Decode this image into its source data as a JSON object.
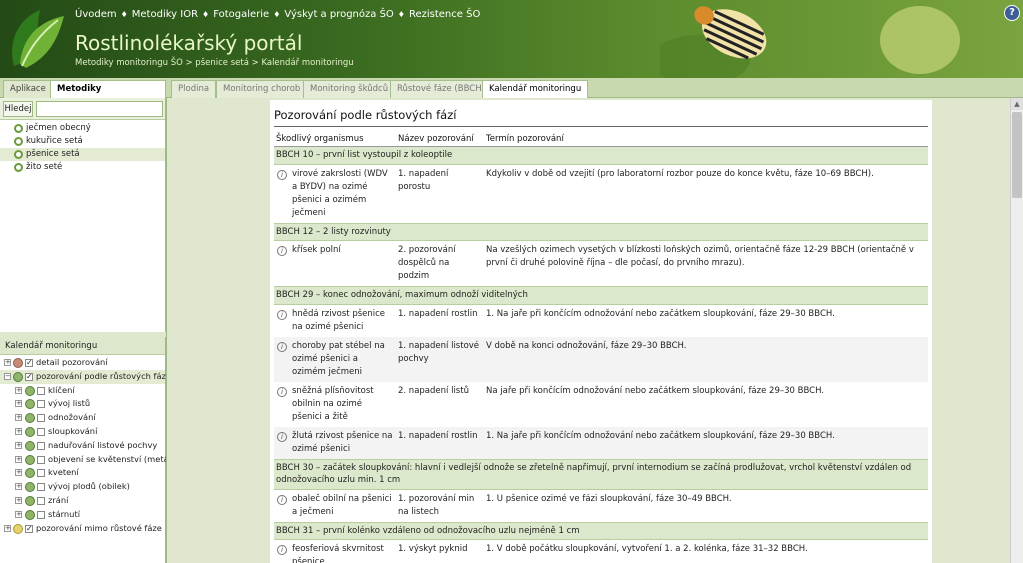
{
  "header": {
    "nav": [
      "Úvodem",
      "Metodiky IOR",
      "Fotogalerie",
      "Výskyt a prognóza ŠO",
      "Rezistence ŠO"
    ],
    "nav_sep": "♦",
    "title": "Rostlinolékařský portál",
    "breadcrumb": "Metodiky monitoringu ŠO > pšenice setá > Kalendář monitoringu",
    "help": "?"
  },
  "left_tabs": [
    "Aplikace",
    "Metodiky monitoringu ŠO"
  ],
  "search": {
    "button": "Hledej",
    "value": ""
  },
  "crops": [
    "ječmen obecný",
    "kukuřice setá",
    "pšenice setá",
    "žito seté"
  ],
  "calendar": {
    "title": "Kalendář monitoringu",
    "nodes": [
      "detail pozorování",
      "pozorování podle růstových fází",
      "klíčení",
      "vývoj listů",
      "odnožování",
      "sloupkování",
      "naduřování listové pochvy",
      "objevení se květenství (metání)",
      "kvetení",
      "vývoj plodů (obilek)",
      "zrání",
      "stárnutí",
      "pozorování mimo růstové fáze"
    ]
  },
  "tabs": [
    "Plodina",
    "Monitoring chorob",
    "Monitoring škůdců",
    "Růstové fáze (BBCH)",
    "Kalendář monitoringu"
  ],
  "panel": {
    "title": "Pozorování podle růstových fází",
    "columns": [
      "Škodlivý organismus",
      "Název pozorování",
      "Termín pozorování"
    ],
    "stages": [
      {
        "label": "BBCH 10 – první list vystoupil z koleoptile",
        "rows": [
          [
            "virové zakrslosti (WDV a BYDV) na ozimé pšenici a ozimém ječmeni",
            "1. napadení porostu",
            "Kdykoliv v době od vzejití (pro laboratorní rozbor pouze do konce květu, fáze 10–69 BBCH)."
          ]
        ]
      },
      {
        "label": "BBCH 12 – 2 listy rozvinuty",
        "rows": [
          [
            "křísek polní",
            "2. pozorování dospělců na podzim",
            "Na vzešlých ozimech vysetých v blízkosti loňských ozimů, orientačně fáze 12-29 BBCH (orientačně v první či druhé polovině října – dle počasí, do prvního mrazu)."
          ]
        ]
      },
      {
        "label": "BBCH 29 – konec odnožování, maximum odnoží viditelných",
        "rows": [
          [
            "hnědá rzivost pšenice na ozimé pšenici",
            "1. napadení rostlin",
            "1. Na jaře při končícím odnožování nebo začátkem sloupkování, fáze 29–30 BBCH."
          ],
          [
            "choroby pat stébel na ozimé pšenici a ozimém ječmeni",
            "1. napadení listové pochvy",
            "V době na konci odnožování, fáze 29–30 BBCH."
          ],
          [
            "sněžná plísňovitost obilnin na ozimé pšenici a žitě",
            "2. napadení listů",
            "Na jaře při končícím odnožování nebo začátkem sloupkování, fáze 29–30 BBCH."
          ],
          [
            "žlutá rzivost pšenice na ozimé pšenici",
            "1. napadení rostlin",
            "1. Na jaře při končícím odnožování nebo začátkem sloupkování, fáze 29–30 BBCH."
          ]
        ]
      },
      {
        "label": "BBCH 30 – začátek sloupkování: hlavní i vedlejší odnože se zřetelně napřimují, první internodium se začíná prodlužovat, vrchol květenství vzdálen od odnožovacího uzlu min. 1 cm",
        "rows": [
          [
            "obaleč obilní na pšenici a ječmeni",
            "1. pozorování min na listech",
            "1. U pšenice ozimé ve fázi sloupkování, fáze 30–49 BBCH."
          ]
        ]
      },
      {
        "label": "BBCH 31 – první kolénko vzdáleno od odnožovacího uzlu nejméně 1 cm",
        "rows": [
          [
            "feosferiová skvrnitost pšenice",
            "1. výskyt pyknid",
            "1. V době počátku sloupkování, vytvoření 1. a 2. kolénka, fáze 31–32 BBCH."
          ]
        ]
      }
    ]
  }
}
